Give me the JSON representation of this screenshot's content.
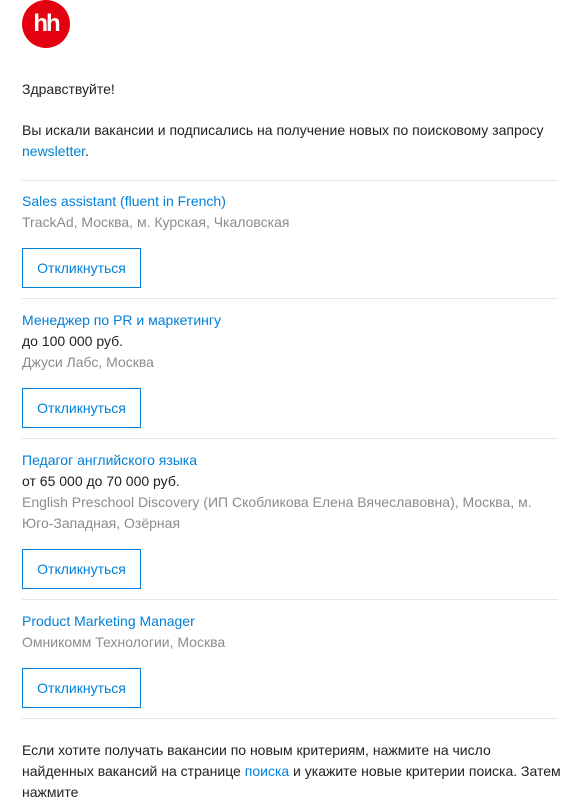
{
  "brand": {
    "logo_text": "hh",
    "color": "#e3000f"
  },
  "accent_color": "#0080d9",
  "greeting": "Здравствуйте!",
  "intro": {
    "text_before": "Вы искали вакансии и подписались на получение новых по поисковому запросу ",
    "query_link": "newsletter",
    "text_after": "."
  },
  "vacancies": [
    {
      "title": "Sales assistant (fluent in French)",
      "salary": "",
      "company": "TrackAd, Москва, м. Курская, Чкаловская",
      "button": "Откликнуться"
    },
    {
      "title": "Менеджер по PR и маркетингу",
      "salary": "до 100 000 руб.",
      "company": "Джуси Лабс, Москва",
      "button": "Откликнуться"
    },
    {
      "title": "Педагог английского языка",
      "salary": "от 65 000 до 70 000 руб.",
      "company": "English Preschool Discovery (ИП Скобликова Елена Вячеславовна), Москва, м. Юго-Западная, Озёрная",
      "button": "Откликнуться"
    },
    {
      "title": "Product Marketing Manager",
      "salary": "",
      "company": "Омникомм Технологии, Москва",
      "button": "Откликнуться"
    }
  ],
  "footer": {
    "text_before": "Если хотите получать вакансии по новым критериям, нажмите на число найденных вакансий на странице ",
    "link": "поиска",
    "text_after": " и укажите новые критерии поиска. Затем нажмите"
  }
}
